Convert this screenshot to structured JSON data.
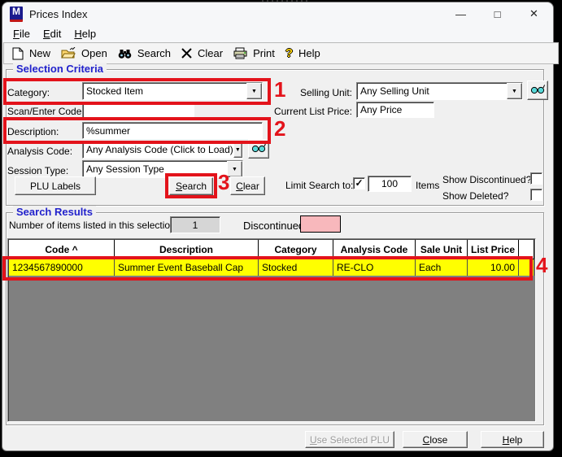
{
  "window": {
    "title": "Prices Index",
    "app_icon_letter": "M"
  },
  "icons": {
    "minimize": "—",
    "maximize": "□",
    "close": "✕",
    "dropdown": "▼",
    "check": "✓"
  },
  "menu": {
    "file": "&File",
    "edit": "&Edit",
    "help": "&Help"
  },
  "toolbar": {
    "new": "New",
    "open": "Open",
    "search": "Search",
    "clear": "Clear",
    "print": "Print",
    "help": "Help"
  },
  "selection_criteria": {
    "title": "Selection Criteria",
    "category": {
      "label": "Category:",
      "value": "Stocked Item"
    },
    "scan_code": {
      "label": "Scan/Enter Code:",
      "value": ""
    },
    "description": {
      "label": "Description:",
      "value": "%summer"
    },
    "analysis_code": {
      "label": "Analysis Code:",
      "value": "Any Analysis Code (Click to Load)"
    },
    "session_type": {
      "label": "Session Type:",
      "value": "Any Session Type"
    },
    "selling_unit": {
      "label": "Selling Unit:",
      "value": "Any Selling Unit"
    },
    "current_list_price": {
      "label": "Current List Price:",
      "value": "Any Price"
    },
    "plu_labels_button": "PLU Labels",
    "search_button": "&Search",
    "clear_button": "&Clear",
    "limit_search": {
      "label": "Limit Search to:",
      "checked": true,
      "value": "100",
      "unit": "Items"
    },
    "show_discontinued": {
      "label": "Show Discontinued?",
      "checked": false
    },
    "show_deleted": {
      "label": "Show Deleted?",
      "checked": false
    }
  },
  "search_results": {
    "title": "Search Results",
    "count_label": "Number of items listed in this selection:",
    "count": "1",
    "discontinued_label": "Discontinued",
    "table": {
      "columns": [
        "Code ^",
        "Description",
        "Category",
        "Analysis Code",
        "Sale Unit",
        "List Price"
      ],
      "rows": [
        [
          "1234567890000",
          "Summer Event Baseball Cap",
          "Stocked",
          "RE-CLO",
          "Each",
          "10.00"
        ]
      ]
    }
  },
  "footer": {
    "use_selected_button": "&Use Selected PLU",
    "close_button": "&Close",
    "help_button": "&Help"
  },
  "annotations": {
    "color": "#e3131b",
    "items": [
      "1",
      "2",
      "3",
      "4"
    ]
  },
  "colors": {
    "section_title": "#2222cc",
    "result_row_highlight": "#ffff00",
    "discontinued_swatch": "#f8b8bc",
    "grid_background": "#808080"
  }
}
